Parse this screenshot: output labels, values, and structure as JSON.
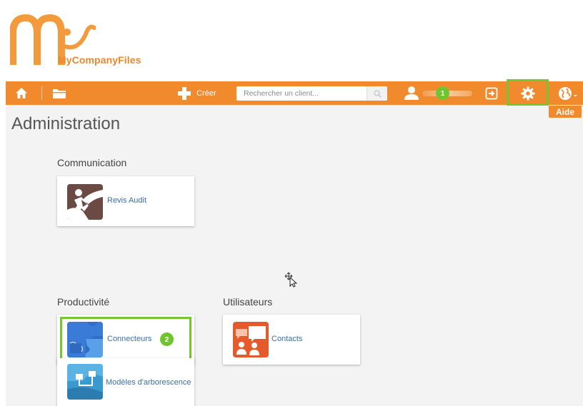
{
  "app": {
    "logo_text": "MyCompanyFiles",
    "brand_color": "#f08a2d",
    "highlight_color": "#77c532"
  },
  "navbar": {
    "home_icon": "home-icon",
    "folder_icon": "folder-icon",
    "create_label": "Créer",
    "search_placeholder": "Rechercher un client...",
    "search_icon": "search-icon",
    "user_icon": "user-icon",
    "logout_icon": "logout-icon",
    "settings_icon": "gear-icon",
    "help_icon": "globe-icon",
    "help_label": "Aide"
  },
  "callouts": {
    "user_step": "1",
    "connectors_step": "2"
  },
  "main": {
    "title": "Administration",
    "sections": [
      {
        "title": "Communication",
        "cards": [
          {
            "label": "Revis Audit",
            "icon": "runner-icon"
          }
        ]
      },
      {
        "title": "Productivité",
        "cards": [
          {
            "label": "Connecteurs",
            "icon": "puzzle-icon"
          },
          {
            "label": "Modèles d'arborescence",
            "icon": "tree-icon"
          }
        ]
      },
      {
        "title": "Utilisateurs",
        "cards": [
          {
            "label": "Contacts",
            "icon": "contacts-icon"
          }
        ]
      }
    ]
  }
}
